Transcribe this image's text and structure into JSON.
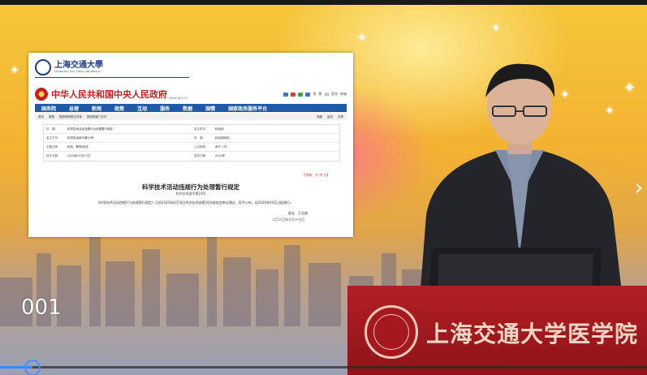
{
  "slide": {
    "counter": "001",
    "progress": 0.05
  },
  "sjtu": {
    "name": "上海交通大學",
    "subtitle": "SHANGHAI JIAO TONG UNIVERSITY"
  },
  "gov": {
    "title": "中华人民共和国中央人民政府",
    "url": "www.gov.cn",
    "tools": [
      "简",
      "繁",
      "EN",
      "登录",
      "邮箱"
    ],
    "nav": [
      "国务院",
      "总理",
      "新闻",
      "政策",
      "互动",
      "服务",
      "数据",
      "国情",
      "国家政务服务平台"
    ],
    "breadcrumb": [
      "首页",
      "政策",
      "国务院政策文件库",
      "国务院部门文件"
    ],
    "page_tools": [
      "收藏",
      "留言",
      "分享"
    ],
    "meta": [
      [
        {
          "k": "标　题：",
          "v": "科学技术活动违规行为处理暂行规定"
        },
        {
          "k": "发文机关：",
          "v": "科技部"
        }
      ],
      [
        {
          "k": "发文字号：",
          "v": "科学技术部令第19号"
        },
        {
          "k": "来　源：",
          "v": "科技部网站"
        }
      ],
      [
        {
          "k": "主题分类：",
          "v": "科技、教育\\科技"
        },
        {
          "k": "公文种类：",
          "v": "命令（令）"
        }
      ],
      [
        {
          "k": "成文日期：",
          "v": "2020年07月17日"
        },
        {
          "k": "发布日期：",
          "v": "2020年"
        }
      ]
    ],
    "font_control": "【字体：大 中 小】",
    "doc_title": "科学技术活动违规行为处理暂行规定",
    "doc_number": "科学技术部令第19号",
    "doc_body": "《科学技术活动违规行为处理暂行规定》已经2020年6月18日科学技术部第16次部务会审议通过，现予公布，自2020年9月1日起施行。",
    "signer": "部长　王志刚",
    "date": "二〇二〇年七月十七日"
  },
  "podium": {
    "text": "上海交通大学医学院"
  },
  "colors": {
    "gov_red": "#c81e1e",
    "nav_blue": "#1e5aa8",
    "podium_red": "#b31e24",
    "progress_blue": "#3a88ff"
  }
}
